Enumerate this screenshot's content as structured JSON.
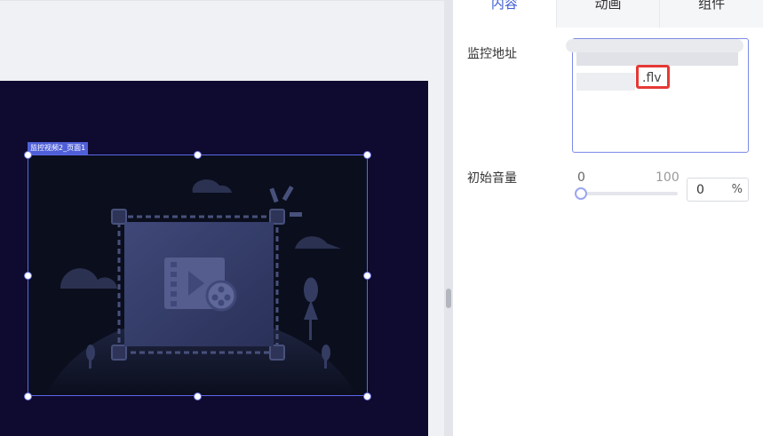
{
  "widget": {
    "tag_label": "监控视频2_页面1"
  },
  "panel": {
    "tabs": [
      {
        "label": "内容",
        "active": true
      },
      {
        "label": "动画",
        "active": false
      },
      {
        "label": "组件",
        "active": false
      }
    ],
    "monitor_url": {
      "label": "监控地址",
      "value": ".flv"
    },
    "volume": {
      "label": "初始音量",
      "min": "0",
      "max": "100",
      "value": "0",
      "unit": "%",
      "level": 0
    }
  },
  "colors": {
    "accent": "#3c5bd6",
    "stage_bg": "#0f0a2f",
    "selection_border": "#5a68e8",
    "highlight": "#e53935"
  }
}
